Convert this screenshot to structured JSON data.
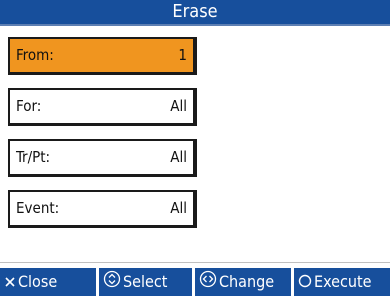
{
  "header": {
    "title": "Erase"
  },
  "params": [
    {
      "label": "From:",
      "value": "1",
      "selected": true
    },
    {
      "label": "For:",
      "value": "All",
      "selected": false
    },
    {
      "label": "Tr/Pt:",
      "value": "All",
      "selected": false
    },
    {
      "label": "Event:",
      "value": "All",
      "selected": false
    }
  ],
  "function_bar": {
    "close_label": "Close",
    "select_label": "Select",
    "change_label": "Change",
    "execute_label": "Execute",
    "close_icon": "x-icon",
    "select_icon": "up-down-icon",
    "change_icon": "left-right-icon",
    "execute_icon": "circle-icon"
  },
  "colors": {
    "header_bg": "#174f9c",
    "selected_bg": "#f0951f",
    "text_light": "#ffffff"
  }
}
